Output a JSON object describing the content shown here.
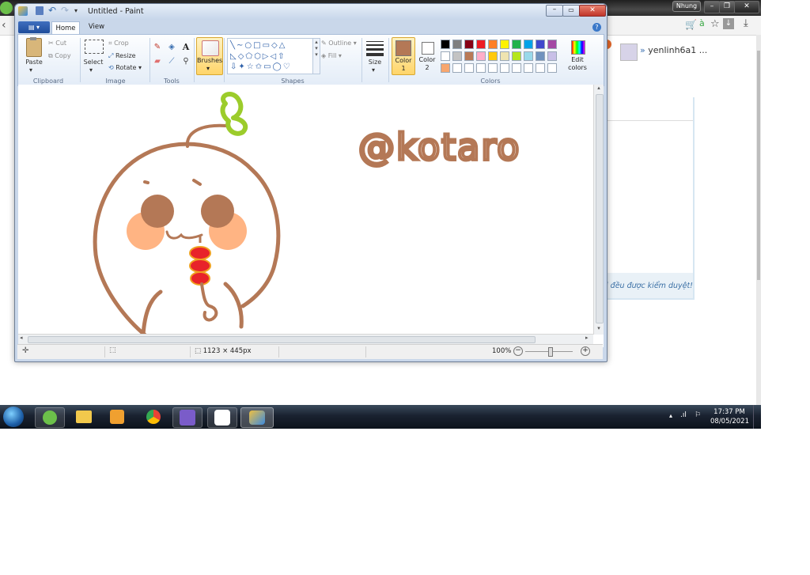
{
  "background_browser": {
    "profile_badge": "Nhung",
    "user_name": "yenlinh6a1 ...",
    "panel_note": "ị đều được kiểm duyệt!"
  },
  "paint": {
    "title": "Untitled - Paint",
    "tabs": [
      {
        "label": "Home"
      },
      {
        "label": "View"
      }
    ],
    "clipboard": {
      "paste": "Paste",
      "cut": "Cut",
      "copy": "Copy",
      "group": "Clipboard"
    },
    "image": {
      "select": "Select",
      "crop": "Crop",
      "resize": "Resize",
      "rotate": "Rotate",
      "group": "Image"
    },
    "tools": {
      "group": "Tools"
    },
    "brushes": {
      "label": "Brushes"
    },
    "shapes": {
      "outline": "Outline",
      "fill": "Fill",
      "group": "Shapes"
    },
    "size": {
      "label": "Size"
    },
    "colors": {
      "color1_label": "Color",
      "color1_num": "1",
      "color2_label": "Color",
      "color2_num": "2",
      "edit_label": "Edit",
      "edit_label2": "colors",
      "group": "Colors",
      "color1": "#b47856",
      "color2": "#ffffff",
      "palette_row1": [
        "#000000",
        "#7f7f7f",
        "#880015",
        "#ed1c24",
        "#ff7f27",
        "#fff200",
        "#22b14c",
        "#00a2e8",
        "#3f48cc",
        "#a349a4"
      ],
      "palette_row2": [
        "#ffffff",
        "#c3c3c3",
        "#b97a57",
        "#ffaec9",
        "#ffc90e",
        "#efe4b0",
        "#b5e61d",
        "#99d9ea",
        "#7092be",
        "#c8bfe7"
      ],
      "palette_row3": [
        "#f7a66e",
        "#ffffff",
        "#ffffff",
        "#ffffff",
        "#ffffff",
        "#ffffff",
        "#ffffff",
        "#ffffff",
        "#ffffff",
        "#ffffff"
      ]
    },
    "canvas": {
      "signature_text": "@kotaro",
      "drawing_colors": {
        "outline": "#b47856",
        "blush": "#ffb483",
        "eyes": "#b47856",
        "leaf": "#9ccc2b",
        "candy": "#e8232a",
        "candy_border": "#f0a020"
      }
    },
    "status": {
      "dimensions": "1123 × 445px",
      "zoom": "100%"
    }
  },
  "taskbar": {
    "time": "17:37 PM",
    "date": "08/05/2021"
  }
}
